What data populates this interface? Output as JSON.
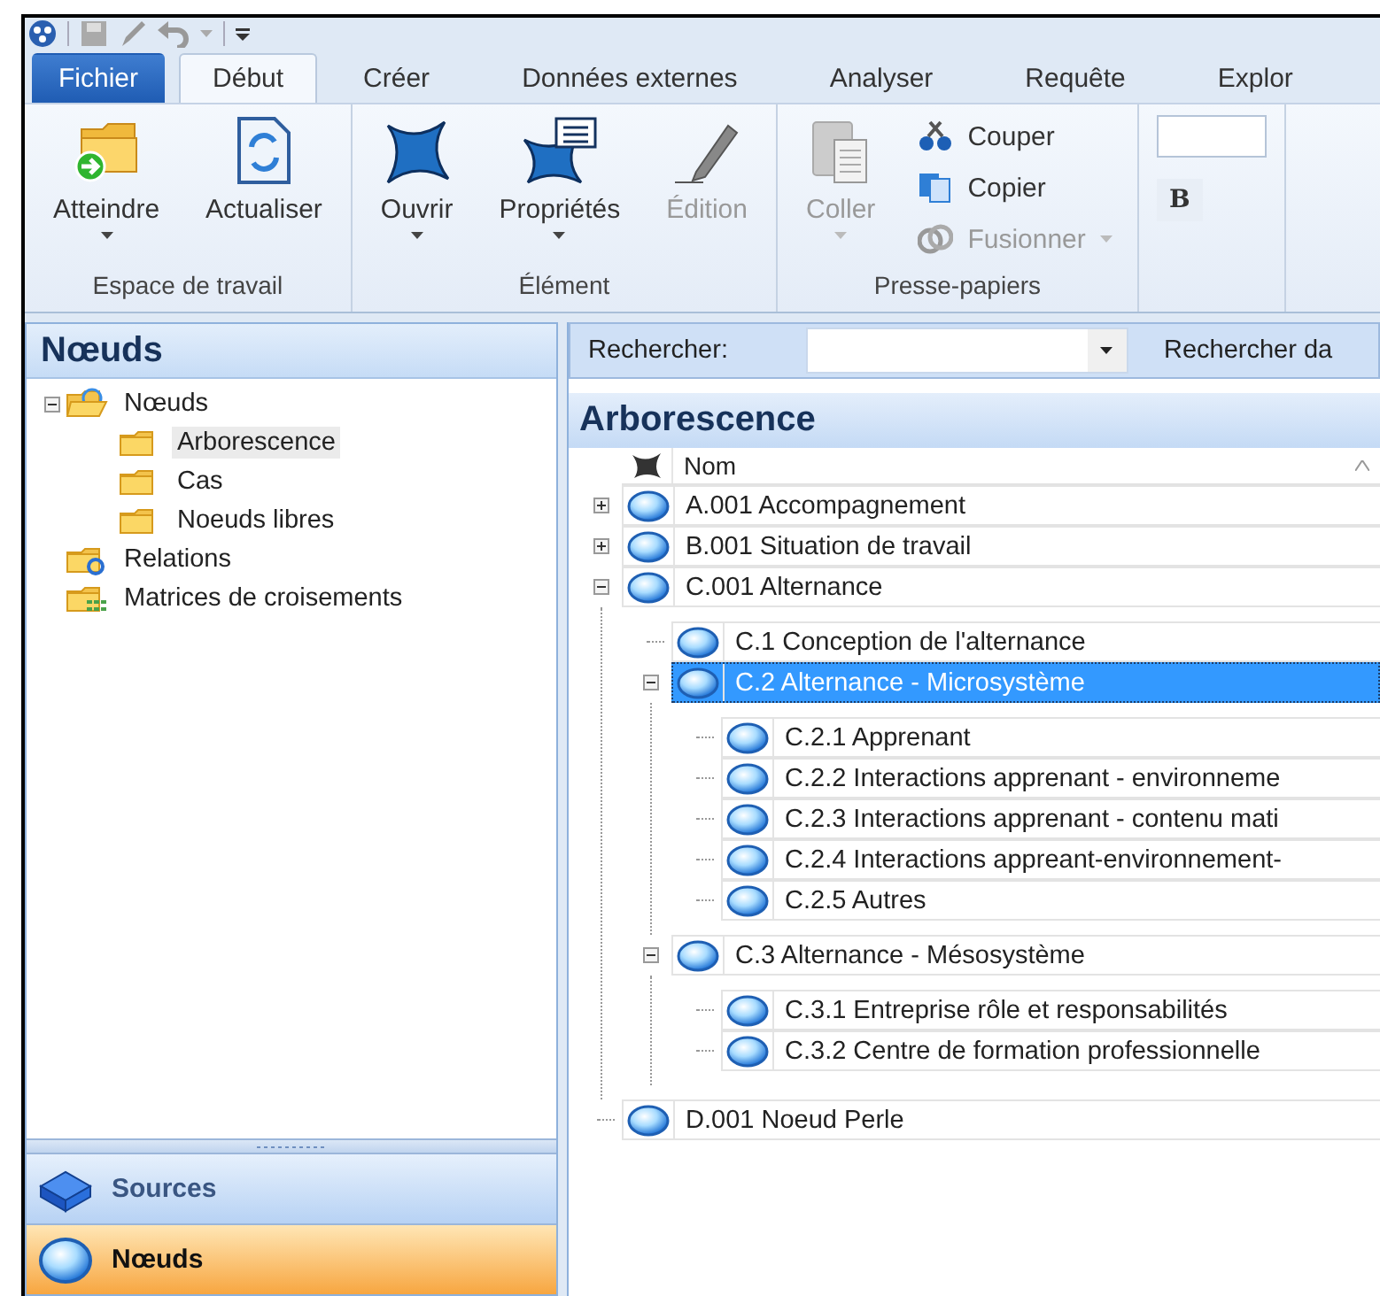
{
  "tabs": [
    {
      "label": "Fichier",
      "kind": "file",
      "selected": false
    },
    {
      "label": "Début",
      "kind": "tab",
      "selected": true
    },
    {
      "label": "Créer",
      "kind": "tab",
      "selected": false
    },
    {
      "label": "Données externes",
      "kind": "tab",
      "selected": false
    },
    {
      "label": "Analyser",
      "kind": "tab",
      "selected": false
    },
    {
      "label": "Requête",
      "kind": "tab",
      "selected": false
    },
    {
      "label": "Explor",
      "kind": "tab",
      "selected": false
    }
  ],
  "ribbon": {
    "groups": [
      {
        "label": "Espace de travail",
        "items": [
          {
            "kind": "large",
            "label": "Atteindre",
            "dropdown": true,
            "disabled": false
          },
          {
            "kind": "large",
            "label": "Actualiser",
            "dropdown": false,
            "disabled": false
          }
        ]
      },
      {
        "label": "Élément",
        "items": [
          {
            "kind": "large",
            "label": "Ouvrir",
            "dropdown": true,
            "disabled": false
          },
          {
            "kind": "large",
            "label": "Propriétés",
            "dropdown": true,
            "disabled": false
          },
          {
            "kind": "large",
            "label": "Édition",
            "dropdown": false,
            "disabled": true
          }
        ]
      },
      {
        "label": "Presse-papiers",
        "items": [
          {
            "kind": "large",
            "label": "Coller",
            "dropdown": true,
            "disabled": true
          },
          {
            "kind": "small",
            "label": "Couper",
            "dropdown": false,
            "disabled": false
          },
          {
            "kind": "small",
            "label": "Copier",
            "dropdown": false,
            "disabled": false
          },
          {
            "kind": "small",
            "label": "Fusionner",
            "dropdown": true,
            "disabled": true
          }
        ]
      },
      {
        "items": [
          {
            "kind": "field"
          },
          {
            "kind": "format",
            "label": "B",
            "disabled": false
          }
        ]
      }
    ]
  },
  "navigation": {
    "title": "Nœuds",
    "tree": [
      {
        "label": "Nœuds",
        "kind": "open-folder",
        "expanded": true,
        "selected": false,
        "children": [
          {
            "label": "Arborescence",
            "kind": "folder",
            "selected": true
          },
          {
            "label": "Cas",
            "kind": "folder",
            "selected": false
          },
          {
            "label": "Noeuds libres",
            "kind": "folder",
            "selected": false
          }
        ]
      },
      {
        "label": "Relations",
        "kind": "relations",
        "selected": false
      },
      {
        "label": "Matrices de croisements",
        "kind": "matrices",
        "selected": false
      }
    ],
    "buttons": [
      {
        "label": "Sources",
        "kind": "sources",
        "selected": false
      },
      {
        "label": "Nœuds",
        "kind": "nodes",
        "selected": true
      }
    ]
  },
  "content": {
    "search": {
      "label": "Rechercher:",
      "scope_label": "Rechercher da"
    },
    "title": "Arborescence",
    "columns": [
      {
        "label": "Nom"
      }
    ],
    "tree": [
      {
        "label": "A.001 Accompagnement",
        "expanded": false,
        "selected": false
      },
      {
        "label": "B.001 Situation de travail",
        "expanded": false,
        "selected": false
      },
      {
        "label": "C.001 Alternance",
        "expanded": true,
        "selected": false,
        "children": [
          {
            "label": "C.1 Conception de l'alternance",
            "selected": false
          },
          {
            "label": "C.2 Alternance - Microsystème",
            "expanded": true,
            "selected": true,
            "children": [
              {
                "label": "C.2.1 Apprenant",
                "selected": false
              },
              {
                "label": "C.2.2 Interactions apprenant - environneme",
                "selected": false
              },
              {
                "label": "C.2.3 Interactions apprenant - contenu mati",
                "selected": false
              },
              {
                "label": "C.2.4 Interactions appreant-environnement-",
                "selected": false
              },
              {
                "label": "C.2.5 Autres",
                "selected": false
              }
            ]
          },
          {
            "label": "C.3 Alternance - Mésosystème",
            "expanded": true,
            "selected": false,
            "children": [
              {
                "label": "C.3.1 Entreprise rôle et responsabilités",
                "selected": false
              },
              {
                "label": "C.3.2 Centre de formation professionnelle",
                "selected": false
              }
            ]
          }
        ]
      },
      {
        "label": "D.001 Noeud Perle",
        "selected": false
      }
    ]
  }
}
